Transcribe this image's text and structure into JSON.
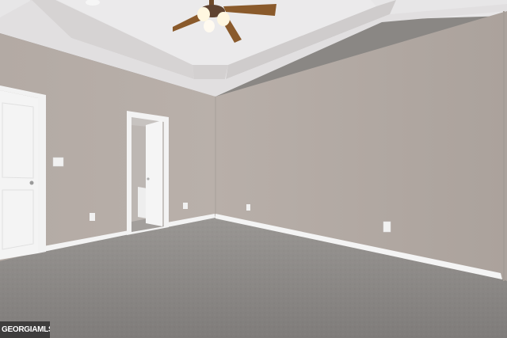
{
  "photo": {
    "subject": "empty-bedroom-interior",
    "colors": {
      "wall": "#b6ada7",
      "wall_shadow": "#a79e98",
      "ceiling": "#e6e5e6",
      "carpet": "#8d8a88",
      "trim": "#f4f4f4",
      "fan_blade": "#8a5a2b"
    }
  },
  "watermark": {
    "text": "GEORGIAMLS"
  }
}
